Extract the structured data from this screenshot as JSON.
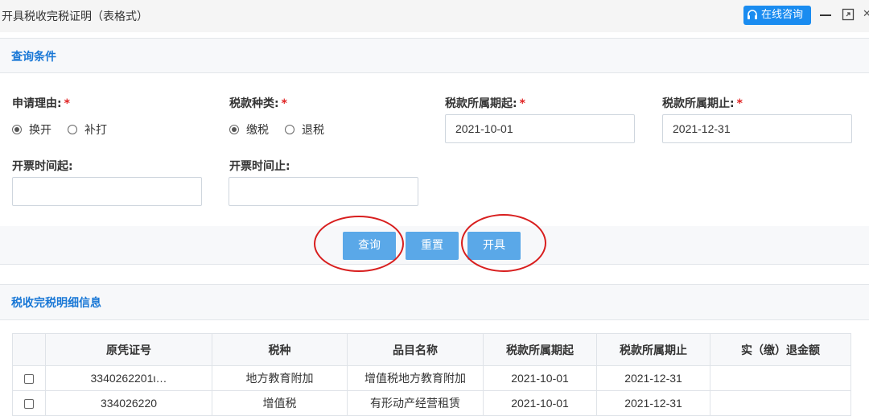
{
  "window": {
    "title": "开具税收完税证明（表格式）",
    "consult_label": "在线咨询"
  },
  "query_panel": {
    "title": "查询条件",
    "reason": {
      "label": "申请理由:",
      "required": "*",
      "options": [
        "换开",
        "补打"
      ],
      "selected": "换开"
    },
    "tax_type": {
      "label": "税款种类:",
      "required": "*",
      "options": [
        "缴税",
        "退税"
      ],
      "selected": "缴税"
    },
    "period_start": {
      "label": "税款所属期起:",
      "required": "*",
      "value": "2021-10-01"
    },
    "period_end": {
      "label": "税款所属期止:",
      "required": "*",
      "value": "2021-12-31"
    },
    "invoice_start": {
      "label": "开票时间起:",
      "value": ""
    },
    "invoice_end": {
      "label": "开票时间止:",
      "value": ""
    },
    "buttons": {
      "query": "查询",
      "reset": "重置",
      "issue": "开具"
    }
  },
  "detail_panel": {
    "title": "税收完税明细信息",
    "columns": [
      "原凭证号",
      "税种",
      "品目名称",
      "税款所属期起",
      "税款所属期止",
      "实（缴）退金额"
    ],
    "rows": [
      {
        "voucher": "3340262201ι…",
        "tax": "地方教育附加",
        "item": "增值税地方教育附加",
        "start": "2021-10-01",
        "end": "2021-12-31",
        "amount": ""
      },
      {
        "voucher": "334026220",
        "tax": "增值税",
        "item": "有形动产经营租赁",
        "start": "2021-10-01",
        "end": "2021-12-31",
        "amount": ""
      }
    ]
  },
  "colors": {
    "accent": "#1a78d6",
    "button": "#5aa8e8",
    "annotation": "#d81e1e"
  }
}
